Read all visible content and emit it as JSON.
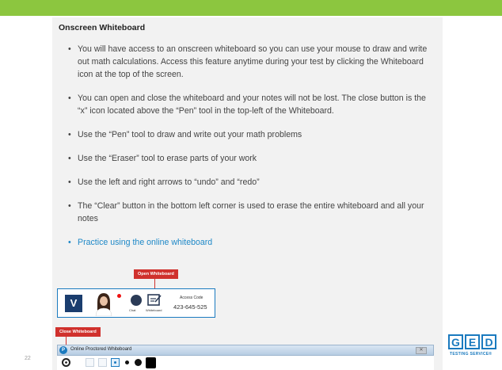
{
  "slide": {
    "title": "Onscreen Whiteboard",
    "page_number": "22",
    "accent_color": "#8cc63f",
    "bullets": [
      "You will have access to an onscreen whiteboard so you can use your mouse to draw and write out math calculations. Access this feature anytime during your test by clicking the Whiteboard icon at the top of the screen.",
      "You can open and close the whiteboard and your notes will not be lost. The close button is the “x” icon located above the “Pen” tool in the top-left of the Whiteboard.",
      "Use the “Pen” tool to draw and write out your math problems",
      "Use the “Eraser” tool to erase parts of your work",
      "Use the left and right arrows to “undo” and “redo”",
      "The “Clear” button in the bottom left corner is used to erase the entire whiteboard and all your notes"
    ],
    "practice_link": "Practice using the online whiteboard",
    "link_color": "#1e88c7"
  },
  "callouts": {
    "open": "Open Whiteboard",
    "close": "Close Whiteboard",
    "color": "#d0312d"
  },
  "toolbar": {
    "logo_letter": "V",
    "chat_label": "Chat",
    "whiteboard_label": "Whiteboard",
    "access_label": "Access Code",
    "access_code": "423-645-525"
  },
  "whiteboard": {
    "title": "Online Proctored Whiteboard",
    "logo_letter": "P",
    "close_glyph": "✕"
  },
  "brand": {
    "letters": [
      "G",
      "E",
      "D"
    ],
    "tagline": "TESTING SERVICE®"
  }
}
